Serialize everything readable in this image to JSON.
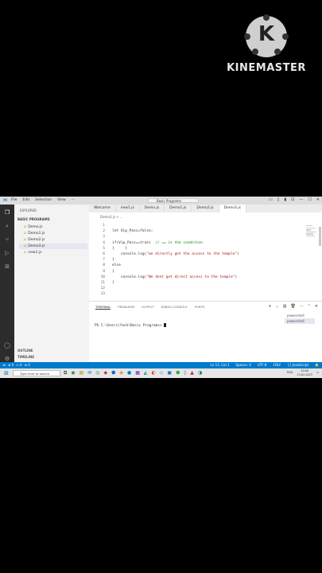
{
  "watermark": {
    "brand": "KINEMASTER",
    "logo_letter": "K"
  },
  "titlebar": {
    "menu": [
      "File",
      "Edit",
      "Selection",
      "View",
      "···"
    ],
    "command_center": "Basic Programs",
    "controls": [
      "▭",
      "▯",
      "▮",
      "⊡",
      "—",
      "☐",
      "✕"
    ]
  },
  "sidebar": {
    "header": "EXPLORER",
    "folder": "BASIC PROGRAMS",
    "files": [
      "Demo.js",
      "Demo1.js",
      "Demo2.js",
      "Demo3.js",
      "new1.js"
    ],
    "active_file": "Demo3.js",
    "outline": "OUTLINE",
    "timeline": "TIMELINE"
  },
  "tabs": [
    "Welcome",
    "new1.js",
    "Demo.js",
    "Demo1.js",
    "Demo2.js",
    "Demo3.js"
  ],
  "breadcrumb": "Demo3.js > ...",
  "code": {
    "line_numbers": [
      "1",
      "2",
      "3",
      "4",
      "5",
      "6",
      "7",
      "8",
      "9",
      "10",
      "11",
      "12",
      "13"
    ],
    "l2": "let Vip_Pass=false;",
    "l4a": "if(Vip_Pass==true)  ",
    "l4b": "// == is the condition",
    "l5": "{     }",
    "l6a": "    console.log(",
    "l6b": "\"we directly get the access to the temple\"",
    "l6c": ")",
    "l7": "}",
    "l8": "else",
    "l9": "{",
    "l10a": "    console.log(",
    "l10b": "\"We dont get direct access to the temple\"",
    "l10c": ")",
    "l11": "}"
  },
  "panel": {
    "tabs": [
      "TERMINAL",
      "PROBLEMS",
      "OUTPUT",
      "DEBUG CONSOLE",
      "PORTS"
    ],
    "controls": [
      "+",
      "⌄",
      "▥",
      "🗑",
      "···",
      "⌃",
      "✕"
    ],
    "prompt": "PS C:\\Users\\Yash\\Basic Programs>",
    "shells": [
      "powershell",
      "powershell"
    ]
  },
  "status": {
    "left": [
      "⊗ 0",
      "⚠ 0",
      "⊕ 0"
    ],
    "right": [
      "Ln 13, Col 1",
      "Spaces: 4",
      "UTF-8",
      "CRLF",
      "{} JavaScript",
      "🔔"
    ]
  },
  "taskbar": {
    "search_placeholder": "Type here to search",
    "apps": [
      "⧉",
      "◉",
      "▤",
      "✉",
      "◎",
      "◆",
      "⬟",
      "◈",
      "●",
      "▦",
      "◭",
      "◐",
      "◇",
      "▣",
      "⬢",
      "◊",
      "▲",
      "◑"
    ],
    "time": "20:08",
    "date": "13-02-2023",
    "lang": "ENG"
  },
  "colors": {
    "accent": "#007acc",
    "string": "#a31515",
    "comment": "#008000"
  }
}
